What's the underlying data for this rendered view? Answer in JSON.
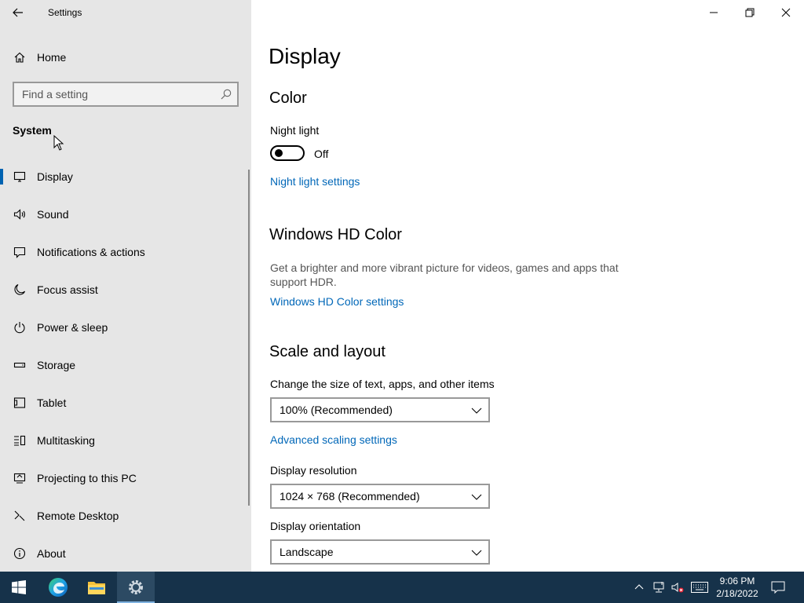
{
  "window": {
    "title": "Settings"
  },
  "sidebar": {
    "home_label": "Home",
    "search_placeholder": "Find a setting",
    "section_title": "System",
    "items": [
      {
        "label": "Display",
        "icon": "monitor-icon",
        "active": true
      },
      {
        "label": "Sound",
        "icon": "speaker-icon",
        "active": false
      },
      {
        "label": "Notifications & actions",
        "icon": "notification-icon",
        "active": false
      },
      {
        "label": "Focus assist",
        "icon": "moon-icon",
        "active": false
      },
      {
        "label": "Power & sleep",
        "icon": "power-icon",
        "active": false
      },
      {
        "label": "Storage",
        "icon": "storage-icon",
        "active": false
      },
      {
        "label": "Tablet",
        "icon": "tablet-icon",
        "active": false
      },
      {
        "label": "Multitasking",
        "icon": "multitasking-icon",
        "active": false
      },
      {
        "label": "Projecting to this PC",
        "icon": "projecting-icon",
        "active": false
      },
      {
        "label": "Remote Desktop",
        "icon": "remote-desktop-icon",
        "active": false
      },
      {
        "label": "About",
        "icon": "info-icon",
        "active": false
      }
    ]
  },
  "main": {
    "page_title": "Display",
    "color_section": {
      "heading": "Color",
      "night_light_label": "Night light",
      "night_light_state": "Off",
      "night_light_link": "Night light settings"
    },
    "hd_color_section": {
      "heading": "Windows HD Color",
      "description": "Get a brighter and more vibrant picture for videos, games and apps that support HDR.",
      "link": "Windows HD Color settings"
    },
    "scale_section": {
      "heading": "Scale and layout",
      "scale_label": "Change the size of text, apps, and other items",
      "scale_value": "100% (Recommended)",
      "advanced_link": "Advanced scaling settings",
      "resolution_label": "Display resolution",
      "resolution_value": "1024 × 768 (Recommended)",
      "orientation_label": "Display orientation",
      "orientation_value": "Landscape"
    }
  },
  "taskbar": {
    "time": "9:06 PM",
    "date": "2/18/2022",
    "colors": {
      "background": "#16324a",
      "accent": "#0067b8"
    }
  }
}
